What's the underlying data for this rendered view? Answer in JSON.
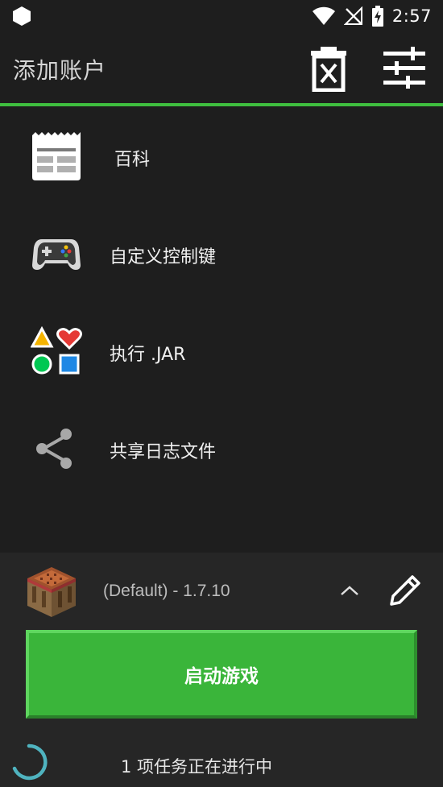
{
  "status_bar": {
    "time": "2:57",
    "icons": [
      "app-notification-icon",
      "wifi-icon",
      "no-signal-icon",
      "battery-charging-icon"
    ]
  },
  "app_bar": {
    "title": "添加账户",
    "delete_icon": "delete-account-icon",
    "settings_icon": "tune-settings-icon"
  },
  "menu": {
    "items": [
      {
        "label": "百科",
        "icon": "wiki-icon"
      },
      {
        "label": "自定义控制键",
        "icon": "gamepad-icon"
      },
      {
        "label": "执行 .JAR",
        "icon": "shapes-icon"
      },
      {
        "label": "共享日志文件",
        "icon": "share-icon"
      }
    ]
  },
  "profile": {
    "label": "(Default) - 1.7.10",
    "icon": "crafting-table-icon"
  },
  "launch": {
    "label": "启动游戏"
  },
  "task": {
    "label": "1 项任务正在进行中"
  },
  "colors": {
    "background": "#1e1e1e",
    "accent": "#3fbf3f",
    "launch_button": "#3ab53a",
    "panel": "#262626"
  }
}
